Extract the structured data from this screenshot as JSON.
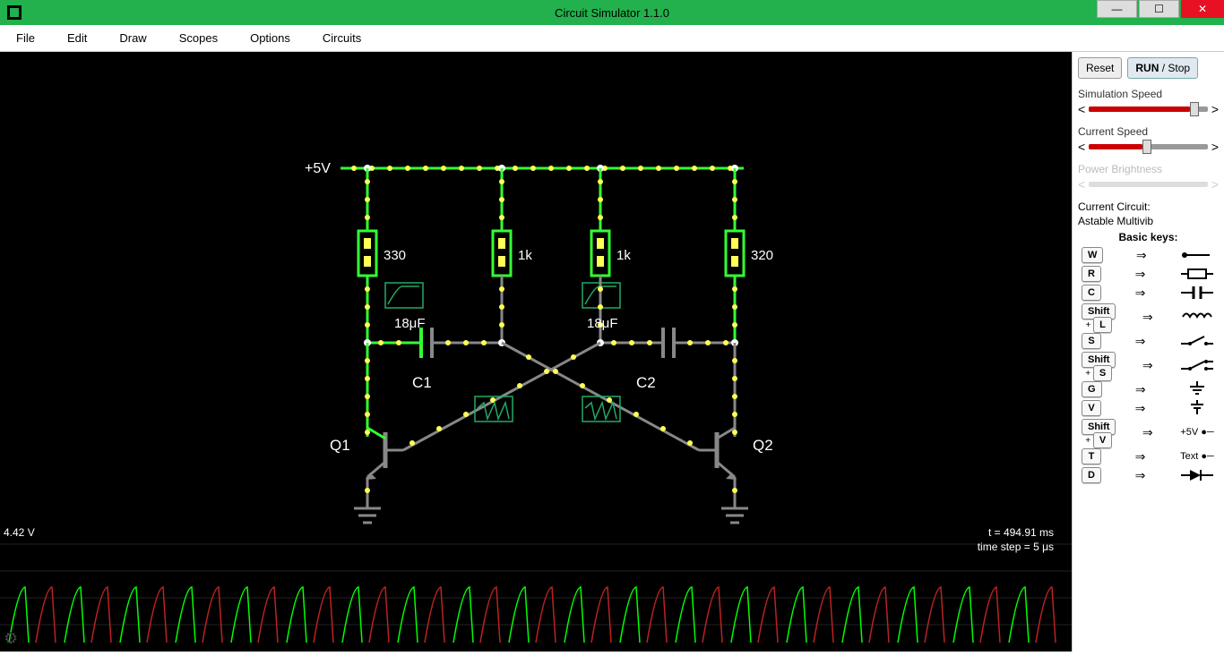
{
  "window": {
    "title": "Circuit Simulator 1.1.0"
  },
  "menu": {
    "file": "File",
    "edit": "Edit",
    "draw": "Draw",
    "scopes": "Scopes",
    "options": "Options",
    "circuits": "Circuits"
  },
  "sidebar": {
    "reset": "Reset",
    "run": "RUN",
    "stop": "Stop",
    "sim_speed_label": "Simulation Speed",
    "current_speed_label": "Current Speed",
    "power_brightness_label": "Power Brightness",
    "current_circuit_label": "Current Circuit:",
    "current_circuit_name": "Astable Multivib",
    "basic_keys_title": "Basic keys:",
    "keys": [
      {
        "k": "W",
        "sym": "wire"
      },
      {
        "k": "R",
        "sym": "resistor"
      },
      {
        "k": "C",
        "sym": "capacitor"
      },
      {
        "k": "Shift+L",
        "sym": "inductor"
      },
      {
        "k": "S",
        "sym": "switch-open"
      },
      {
        "k": "Shift+S",
        "sym": "switch-closed"
      },
      {
        "k": "G",
        "sym": "ground"
      },
      {
        "k": "V",
        "sym": "voltage"
      },
      {
        "k": "Shift+V",
        "sym": "+5V",
        "text": "+5V"
      },
      {
        "k": "T",
        "sym": "text",
        "text": "Text"
      },
      {
        "k": "D",
        "sym": "diode"
      }
    ]
  },
  "circuit": {
    "voltage_label": "+5V",
    "r1": "330",
    "r2": "1k",
    "r3": "1k",
    "r4": "320",
    "c1_val": "18μF",
    "c2_val": "18μF",
    "c1_label": "C1",
    "c2_label": "C2",
    "q1_label": "Q1",
    "q2_label": "Q2"
  },
  "scope": {
    "voltage": "4.42 V",
    "time": "t = 494.91 ms",
    "timestep": "time step = 5 μs"
  }
}
